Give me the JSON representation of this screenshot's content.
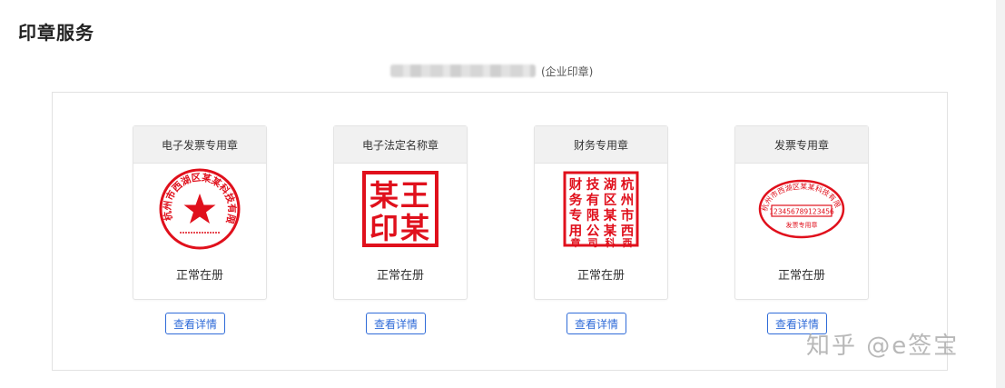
{
  "page": {
    "title": "印章服务"
  },
  "company": {
    "suffix": "(企业印章)"
  },
  "seals": [
    {
      "name": "电子发票专用章",
      "status": "正常在册",
      "detail_label": "查看详情",
      "seal_text": "杭州市西湖区某某科技有限公司"
    },
    {
      "name": "电子法定名称章",
      "status": "正常在册",
      "detail_label": "查看详情",
      "seal_text": "王某某印"
    },
    {
      "name": "财务专用章",
      "status": "正常在册",
      "detail_label": "查看详情",
      "seal_text": "杭州市西湖区某某科技有限公司财务专用章"
    },
    {
      "name": "发票专用章",
      "status": "正常在册",
      "detail_label": "查看详情",
      "seal_text": "杭州市西湖区某某科技有限公司",
      "seal_number": "123456789123456",
      "seal_sub": "发票专用章"
    }
  ],
  "watermark": "知乎 @e签宝",
  "colors": {
    "seal_red": "#e0101c",
    "link_blue": "#2f6bd8"
  }
}
